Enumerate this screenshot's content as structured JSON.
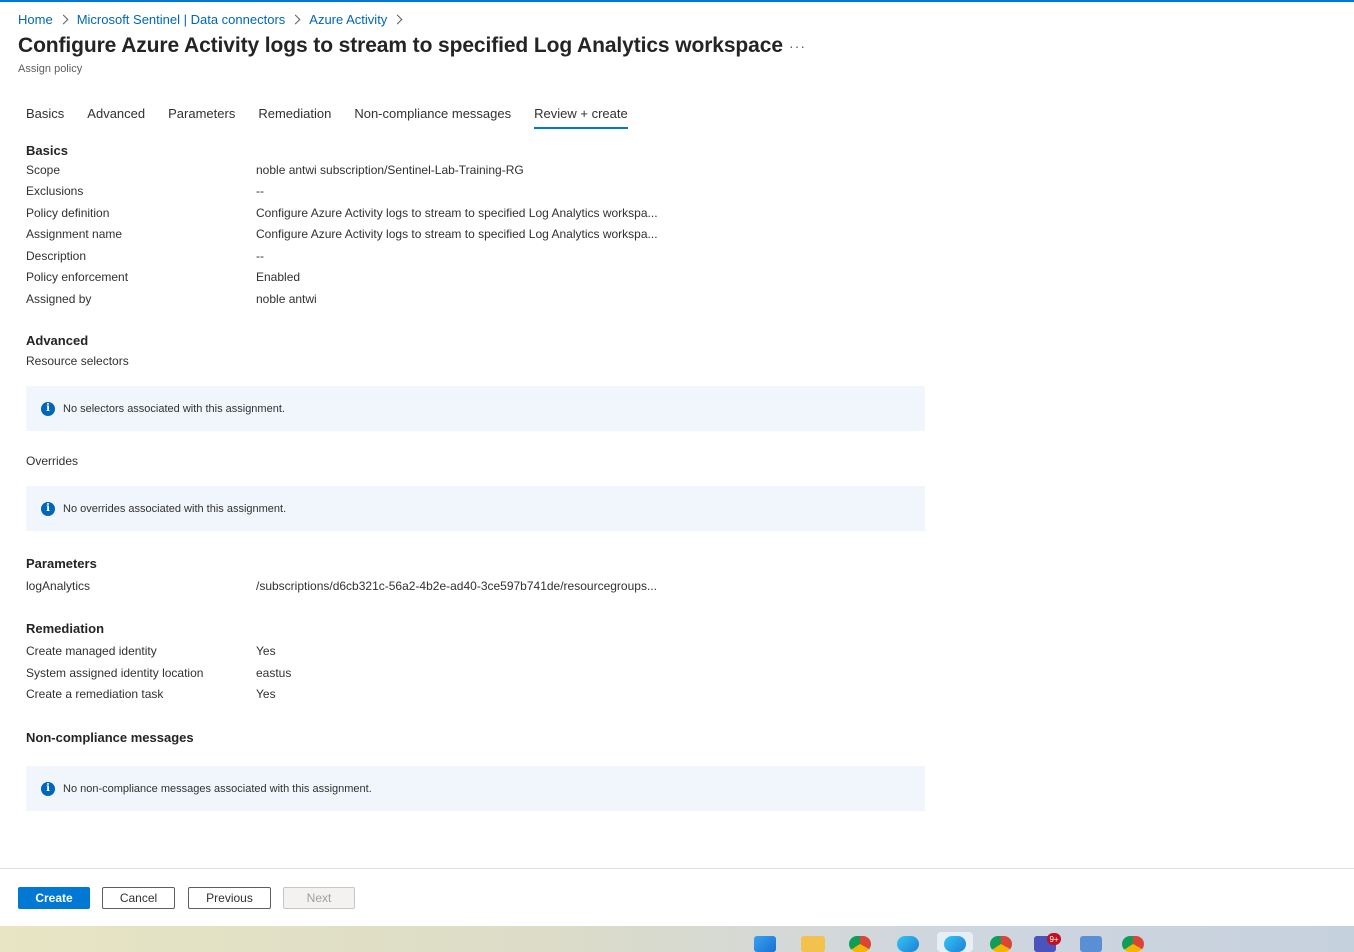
{
  "breadcrumb": [
    "Home",
    "Microsoft Sentinel | Data connectors",
    "Azure Activity"
  ],
  "header": {
    "title": "Configure Azure Activity logs to stream to specified Log Analytics workspace",
    "more": "···",
    "subtitle": "Assign policy"
  },
  "tabs": [
    "Basics",
    "Advanced",
    "Parameters",
    "Remediation",
    "Non-compliance messages",
    "Review + create"
  ],
  "active_tab": "Review + create",
  "basics": {
    "heading": "Basics",
    "rows": [
      {
        "label": "Scope",
        "value": "noble antwi subscription/Sentinel-Lab-Training-RG"
      },
      {
        "label": "Exclusions",
        "value": "--"
      },
      {
        "label": "Policy definition",
        "value": "Configure Azure Activity logs to stream to specified Log Analytics workspa..."
      },
      {
        "label": "Assignment name",
        "value": "Configure Azure Activity logs to stream to specified Log Analytics workspa..."
      },
      {
        "label": "Description",
        "value": "--"
      },
      {
        "label": "Policy enforcement",
        "value": "Enabled"
      },
      {
        "label": "Assigned by",
        "value": "noble antwi"
      }
    ]
  },
  "advanced": {
    "heading": "Advanced",
    "resource_selectors_label": "Resource selectors",
    "selectors_message": "No selectors associated with this assignment.",
    "overrides_label": "Overrides",
    "overrides_message": "No overrides associated with this assignment."
  },
  "parameters": {
    "heading": "Parameters",
    "rows": [
      {
        "label": "logAnalytics",
        "value": "/subscriptions/d6cb321c-56a2-4b2e-ad40-3ce597b741de/resourcegroups..."
      }
    ]
  },
  "remediation": {
    "heading": "Remediation",
    "rows": [
      {
        "label": "Create managed identity",
        "value": "Yes"
      },
      {
        "label": "System assigned identity location",
        "value": "eastus"
      },
      {
        "label": "Create a remediation task",
        "value": "Yes"
      }
    ]
  },
  "noncompliance": {
    "heading": "Non-compliance messages",
    "message": "No non-compliance messages associated with this assignment."
  },
  "footer": {
    "create": "Create",
    "cancel": "Cancel",
    "previous": "Previous",
    "next": "Next"
  },
  "taskbar": {
    "teams_badge": "9+"
  },
  "colors": {
    "accent": "#0078d4",
    "link": "#0067b8",
    "info_bg": "#f0f6fc"
  }
}
